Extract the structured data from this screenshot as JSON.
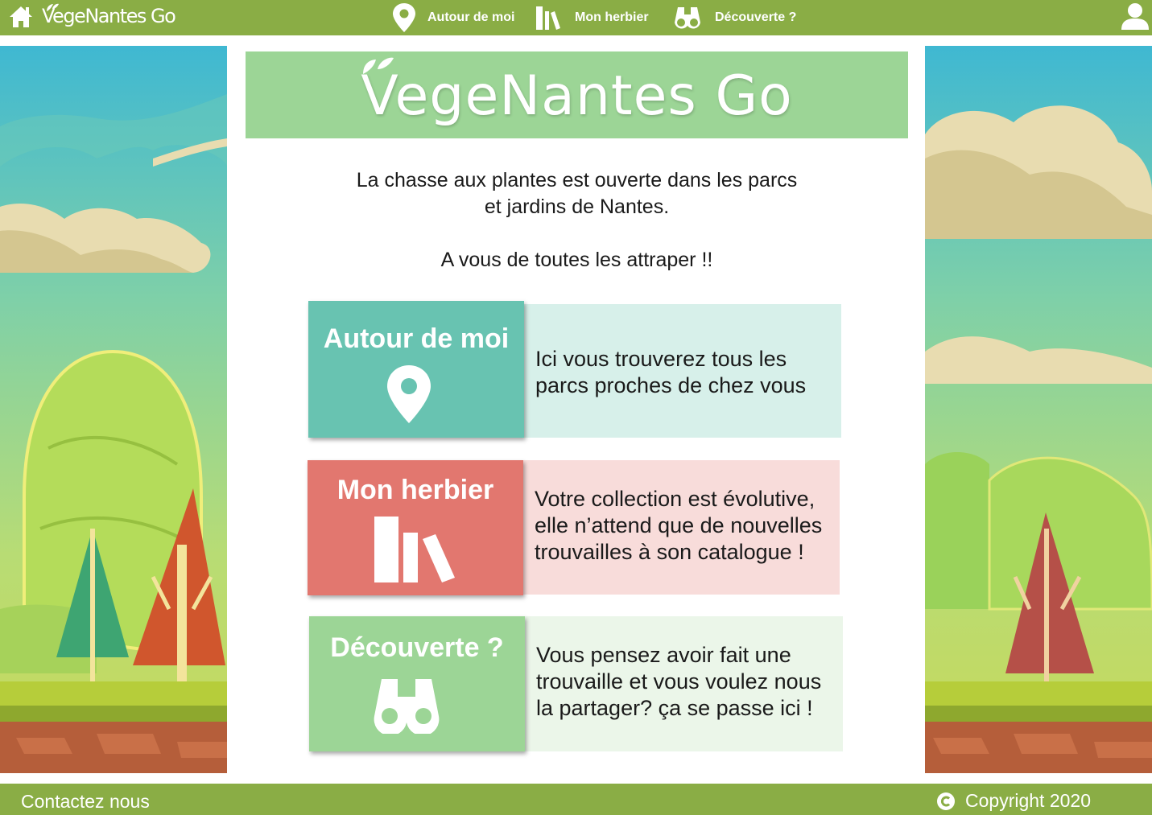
{
  "header": {
    "brand": "VegeNantes Go",
    "nav": [
      {
        "label": "Autour de moi",
        "icon": "map-pin-icon"
      },
      {
        "label": "Mon herbier",
        "icon": "books-icon"
      },
      {
        "label": "Découverte ?",
        "icon": "binoculars-icon"
      }
    ]
  },
  "banner": {
    "logo_text": "VegeNantes Go"
  },
  "intro": {
    "line1": "La chasse aux plantes est ouverte dans les parcs",
    "line2": "et jardins de Nantes.",
    "line3": "A vous de toutes les attraper !!"
  },
  "cards": [
    {
      "title": "Autour de moi",
      "icon": "map-pin-icon",
      "desc_lines": [
        "Ici vous trouverez tous les",
        "parcs proches de chez vous"
      ],
      "btn_color": "#68c3b1",
      "desc_color": "#d7f0ea"
    },
    {
      "title": "Mon herbier",
      "icon": "books-icon",
      "desc_lines": [
        "Votre collection est évolutive,",
        "elle n’attend que de nouvelles",
        "trouvailles à son catalogue !"
      ],
      "btn_color": "#e2776f",
      "desc_color": "#f8dcda"
    },
    {
      "title": "Découverte ?",
      "icon": "binoculars-icon",
      "desc_lines": [
        "Vous pensez avoir fait une",
        "trouvaille et vous voulez nous",
        "la partager? ça se passe ici !"
      ],
      "btn_color": "#9cd596",
      "desc_color": "#ebf6e9"
    }
  ],
  "footer": {
    "contact": "Contactez nous",
    "copyright": "Copyright 2020"
  },
  "colors": {
    "bar": "#8aad45",
    "banner": "#9cd596"
  }
}
